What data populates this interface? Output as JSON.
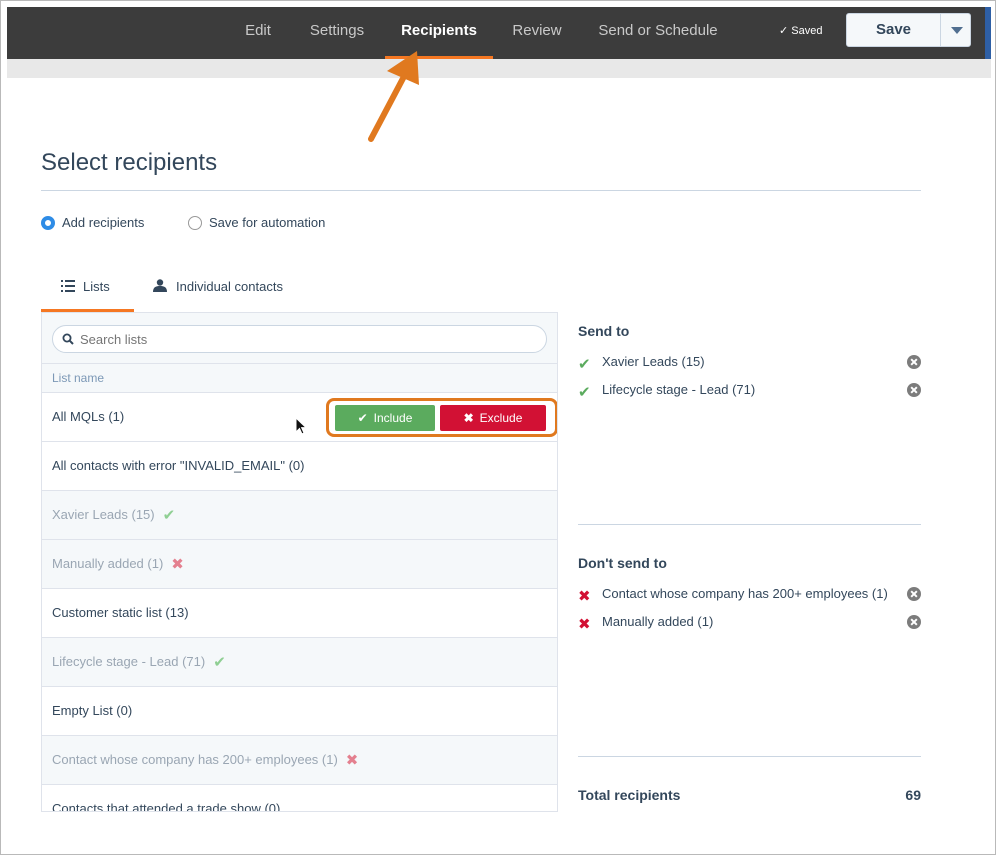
{
  "nav": {
    "tabs": [
      {
        "label": "Edit"
      },
      {
        "label": "Settings"
      },
      {
        "label": "Recipients"
      },
      {
        "label": "Review"
      },
      {
        "label": "Send or Schedule"
      }
    ],
    "active_tab": "Recipients",
    "saved_label": "Saved",
    "save_label": "Save"
  },
  "page": {
    "title": "Select recipients",
    "radio_options": [
      {
        "label": "Add recipients",
        "selected": true
      },
      {
        "label": "Save for automation",
        "selected": false
      }
    ],
    "tabs": [
      {
        "label": "Lists",
        "icon": "list-icon"
      },
      {
        "label": "Individual contacts",
        "icon": "person-icon"
      }
    ]
  },
  "lists": {
    "search_placeholder": "Search lists",
    "column_header": "List name",
    "include_label": "Include",
    "exclude_label": "Exclude",
    "rows": [
      {
        "name": "All MQLs (1)",
        "state": "hover"
      },
      {
        "name": "All contacts with error \"INVALID_EMAIL\" (0)",
        "state": "none"
      },
      {
        "name": "Xavier Leads (15)",
        "state": "included"
      },
      {
        "name": "Manually added (1)",
        "state": "excluded"
      },
      {
        "name": "Customer static list (13)",
        "state": "none"
      },
      {
        "name": "Lifecycle stage - Lead (71)",
        "state": "included"
      },
      {
        "name": "Empty List (0)",
        "state": "none"
      },
      {
        "name": "Contact whose company has 200+ employees (1)",
        "state": "excluded"
      },
      {
        "name": "Contacts that attended a trade show (0)",
        "state": "none"
      }
    ]
  },
  "summary": {
    "send_to_heading": "Send to",
    "send_to": [
      "Xavier Leads (15)",
      "Lifecycle stage - Lead (71)"
    ],
    "dont_send_heading": "Don't send to",
    "dont_send": [
      "Contact whose company has 200+ employees (1)",
      "Manually added (1)"
    ],
    "total_label": "Total recipients",
    "total_value": "69"
  },
  "colors": {
    "accent_orange": "#f57722",
    "include_green": "#5bab5e",
    "exclude_red": "#d21134"
  }
}
